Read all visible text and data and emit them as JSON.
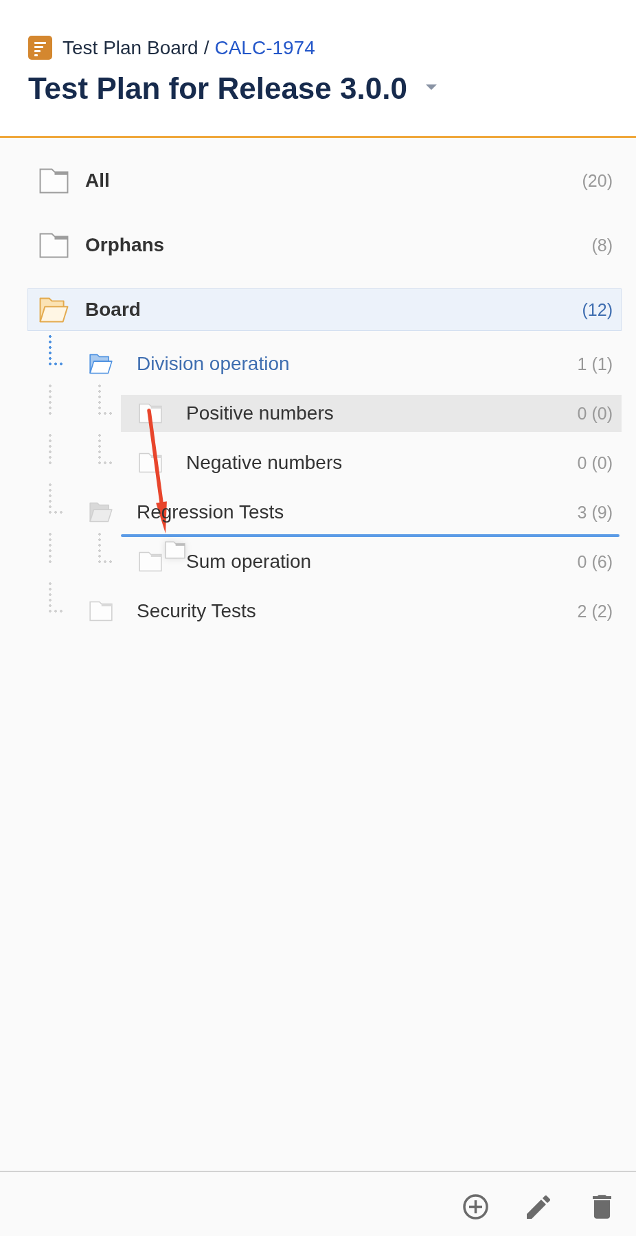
{
  "header": {
    "breadcrumb": {
      "board": "Test Plan Board",
      "separator": "/",
      "issue_key": "CALC-1974"
    },
    "title": "Test Plan for Release 3.0.0"
  },
  "tree": {
    "items": [
      {
        "label": "All",
        "count": "(20)",
        "kind": "root",
        "selected": false,
        "expanded": false,
        "highlighted": false,
        "dragging": false,
        "drop_target": false
      },
      {
        "label": "Orphans",
        "count": "(8)",
        "kind": "root",
        "selected": false,
        "expanded": false,
        "highlighted": false,
        "dragging": false,
        "drop_target": false
      },
      {
        "label": "Board",
        "count": "(12)",
        "kind": "root",
        "selected": true,
        "expanded": true,
        "highlighted": false,
        "dragging": false,
        "drop_target": false,
        "children": [
          {
            "label": "Division operation",
            "count": "1 (1)",
            "kind": "folder",
            "selected": false,
            "expanded": true,
            "highlighted": true,
            "dragging": false,
            "drop_target": false,
            "children": [
              {
                "label": "Positive numbers",
                "count": "0 (0)",
                "kind": "folder",
                "selected": false,
                "expanded": false,
                "highlighted": false,
                "dragging": true,
                "drop_target": false
              },
              {
                "label": "Negative numbers",
                "count": "0 (0)",
                "kind": "folder",
                "selected": false,
                "expanded": false,
                "highlighted": false,
                "dragging": false,
                "drop_target": false
              }
            ]
          },
          {
            "label": "Regression Tests",
            "count": "3 (9)",
            "kind": "folder",
            "selected": false,
            "expanded": true,
            "highlighted": false,
            "dragging": false,
            "drop_target": true,
            "children": [
              {
                "label": "Sum operation",
                "count": "0 (6)",
                "kind": "folder",
                "selected": false,
                "expanded": false,
                "highlighted": false,
                "dragging": false,
                "drop_target": false
              }
            ]
          },
          {
            "label": "Security Tests",
            "count": "2 (2)",
            "kind": "folder",
            "selected": false,
            "expanded": false,
            "highlighted": false,
            "dragging": false,
            "drop_target": false
          }
        ]
      }
    ]
  },
  "annotations": [
    {
      "kind": "arrow"
    }
  ],
  "toolbar": {
    "buttons": [
      {
        "kind": "add"
      },
      {
        "kind": "edit"
      },
      {
        "kind": "delete"
      }
    ]
  }
}
